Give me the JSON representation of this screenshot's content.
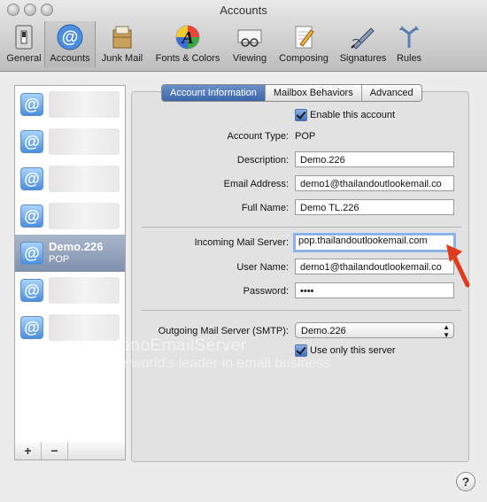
{
  "window": {
    "title": "Accounts"
  },
  "toolbar": {
    "items": [
      {
        "label": "General"
      },
      {
        "label": "Accounts"
      },
      {
        "label": "Junk Mail"
      },
      {
        "label": "Fonts & Colors"
      },
      {
        "label": "Viewing"
      },
      {
        "label": "Composing"
      },
      {
        "label": "Signatures"
      },
      {
        "label": "Rules"
      }
    ]
  },
  "accounts": {
    "selected": {
      "name": "Demo.226",
      "type": "POP"
    },
    "add_label": "+",
    "remove_label": "−"
  },
  "tabs": [
    {
      "label": "Account Information"
    },
    {
      "label": "Mailbox Behaviors"
    },
    {
      "label": "Advanced"
    }
  ],
  "form": {
    "enable_label": "Enable this account",
    "account_type_label": "Account Type:",
    "account_type_value": "POP",
    "description_label": "Description:",
    "description_value": "Demo.226",
    "email_label": "Email Address:",
    "email_value": "demo1@thailandoutlookemail.co",
    "fullname_label": "Full Name:",
    "fullname_value": "Demo TL.226",
    "incoming_label": "Incoming Mail Server:",
    "incoming_value": "pop.thailandoutlookemail.com",
    "username_label": "User Name:",
    "username_value": "demo1@thailandoutlookemail.co",
    "password_label": "Password:",
    "password_value": "••••",
    "smtp_label": "Outgoing Mail Server (SMTP):",
    "smtp_value": "Demo.226",
    "use_only_label": "Use only this server"
  },
  "watermark": {
    "line1": "MonoEmailServer",
    "line2": "The world's leader in email business"
  },
  "help_label": "?"
}
